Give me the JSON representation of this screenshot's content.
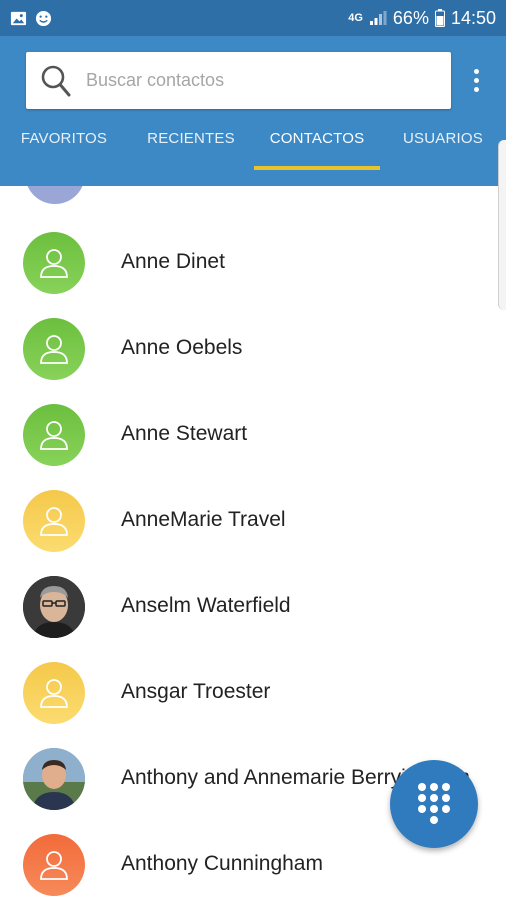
{
  "status_bar": {
    "network": "4G",
    "battery_percent": "66%",
    "time": "14:50",
    "left_icons": [
      "gallery-icon",
      "face-icon"
    ]
  },
  "search": {
    "placeholder": "Buscar contactos",
    "value": ""
  },
  "tabs": [
    {
      "label": "FAVORITOS",
      "active": false
    },
    {
      "label": "RECIENTES",
      "active": false
    },
    {
      "label": "CONTACTOS",
      "active": true
    },
    {
      "label": "USUARIOS",
      "active": false
    }
  ],
  "contacts": [
    {
      "name": "Anne Dinet",
      "avatar": "person-icon",
      "color": "#6cbf3e"
    },
    {
      "name": "Anne Oebels",
      "avatar": "person-icon",
      "color": "#6cbf3e"
    },
    {
      "name": "Anne Stewart",
      "avatar": "person-icon",
      "color": "#6cbf3e"
    },
    {
      "name": "AnneMarie Travel",
      "avatar": "person-icon",
      "color": "#f5c84a"
    },
    {
      "name": "Anselm Waterfield",
      "avatar": "photo",
      "color": "#3a3a3a"
    },
    {
      "name": "Ansgar Troester",
      "avatar": "person-icon",
      "color": "#f5c84a"
    },
    {
      "name": "Anthony and Annemarie Berryingham",
      "avatar": "photo",
      "color": "#6f8fb2"
    },
    {
      "name": "Anthony Cunningham",
      "avatar": "person-icon",
      "color": "#f26b3a"
    }
  ],
  "colors": {
    "status_bar": "#2e6fa8",
    "app_bar": "#3d89c5",
    "tab_indicator": "#e8c32b",
    "fab": "#2f7bbd"
  },
  "fab": {
    "icon": "dialpad-icon"
  }
}
